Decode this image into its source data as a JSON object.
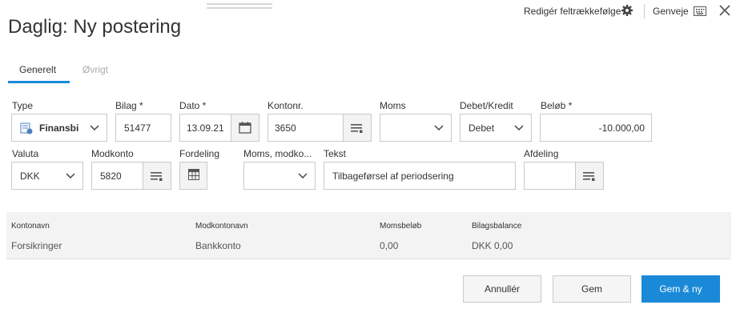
{
  "header": {
    "title": "Daglig: Ny postering",
    "edit_order_label": "Redigér feltrækkefølge",
    "shortcut_label": "Genveje"
  },
  "tabs": [
    {
      "label": "Generelt",
      "active": true
    },
    {
      "label": "Øvrigt",
      "active": false
    }
  ],
  "form": {
    "type": {
      "label": "Type",
      "value": "Finansbi"
    },
    "bilag": {
      "label": "Bilag *",
      "value": "51477"
    },
    "dato": {
      "label": "Dato *",
      "value": "13.09.21"
    },
    "kontonr": {
      "label": "Kontonr.",
      "value": "3650"
    },
    "moms": {
      "label": "Moms",
      "value": ""
    },
    "debet_kredit": {
      "label": "Debet/Kredit",
      "value": "Debet"
    },
    "beloeb": {
      "label": "Beløb *",
      "value": "-10.000,00"
    },
    "valuta": {
      "label": "Valuta",
      "value": "DKK"
    },
    "modkonto": {
      "label": "Modkonto",
      "value": "5820"
    },
    "fordeling": {
      "label": "Fordeling"
    },
    "moms_modkonto": {
      "label": "Moms, modko...",
      "value": ""
    },
    "tekst": {
      "label": "Tekst",
      "value": "Tilbageførsel af periodsering"
    },
    "afdeling": {
      "label": "Afdeling",
      "value": ""
    }
  },
  "summary": {
    "headers": [
      "Kontonavn",
      "Modkontonavn",
      "Momsbeløb",
      "Bilagsbalance"
    ],
    "values": [
      "Forsikringer",
      "Bankkonto",
      "0,00",
      "DKK 0,00"
    ]
  },
  "buttons": {
    "cancel": "Annullér",
    "save": "Gem",
    "save_new": "Gem & ny"
  },
  "colors": {
    "accent": "#1a8ad8",
    "summary_bg": "#f3f3f3",
    "border": "#c9c9c9"
  }
}
